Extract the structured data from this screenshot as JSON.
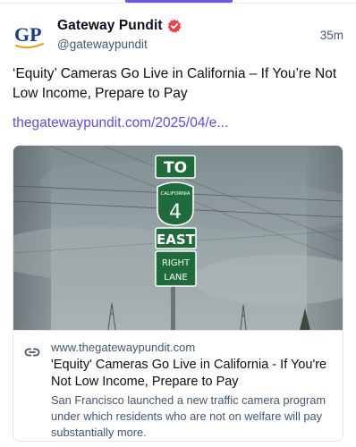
{
  "ui": {
    "accent_color": "#6e56e8",
    "link_color": "#5b4ee6",
    "verified_color": "#e8424f"
  },
  "post": {
    "author": {
      "display_name": "Gateway Pundit",
      "handle": "@gatewaypundit",
      "avatar_text": "GP",
      "verified": true,
      "verified_icon": "verified-badge-icon"
    },
    "timestamp": "35m",
    "text": "‘Equity’ Cameras Go Live in California – If You’re Not Low Income, Prepare to Pay",
    "link_text": "thegatewaypundit.com/2025/04/e..."
  },
  "card": {
    "icon": "link-icon",
    "image": {
      "sign_top": "TO",
      "shield_label": "CALIFORNIA",
      "shield_number": "4",
      "direction": "EAST",
      "lane_line1": "RIGHT",
      "lane_line2": "LANE"
    },
    "domain": "www.thegatewaypundit.com",
    "title": "'Equity' Cameras Go Live in California - If You're Not Low Income, Prepare to Pay",
    "description": "San Francisco launched a new traffic camera program under which residents who are not on welfare will pay substantially more."
  }
}
